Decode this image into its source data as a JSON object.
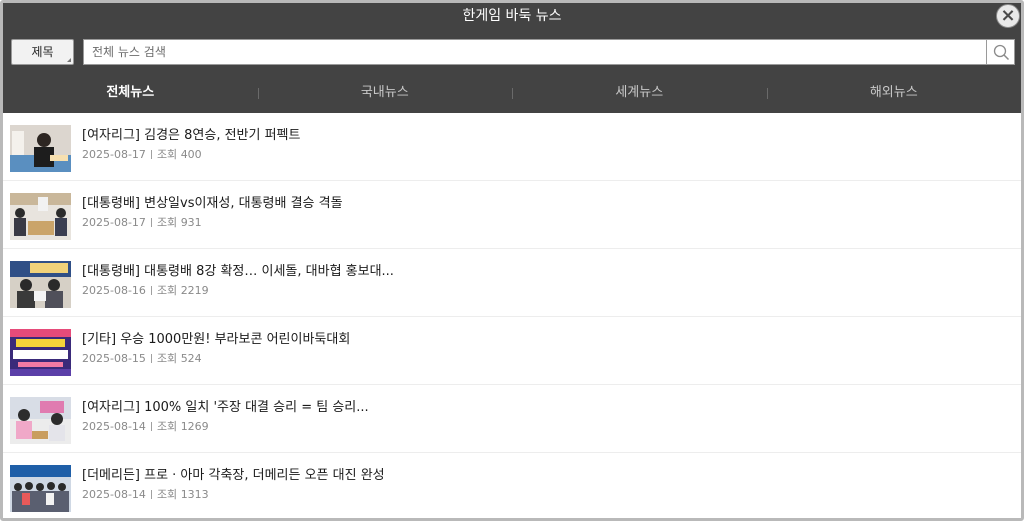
{
  "window": {
    "title": "한게임 바둑 뉴스",
    "close_icon": "close-icon"
  },
  "search": {
    "field_label": "제목",
    "placeholder": "전체 뉴스 검색",
    "value": "",
    "button_icon": "search-icon"
  },
  "tabs": [
    {
      "label": "전체뉴스",
      "active": true
    },
    {
      "label": "국내뉴스",
      "active": false
    },
    {
      "label": "세계뉴스",
      "active": false
    },
    {
      "label": "해외뉴스",
      "active": false
    }
  ],
  "news": [
    {
      "title": "[여자리그] 김경은 8연승, 전반기 퍼펙트",
      "date": "2025-08-17",
      "views_label": "조회",
      "views": "400"
    },
    {
      "title": "[대통령배] 변상일vs이재성, 대통령배 결승 격돌",
      "date": "2025-08-17",
      "views_label": "조회",
      "views": "931"
    },
    {
      "title": "[대통령배] 대통령배 8강 확정… 이세돌, 대바협 홍보대...",
      "date": "2025-08-16",
      "views_label": "조회",
      "views": "2219"
    },
    {
      "title": "[기타] 우승 1000만원! 부라보콘 어린이바둑대회",
      "date": "2025-08-15",
      "views_label": "조회",
      "views": "524"
    },
    {
      "title": "[여자리그] 100% 일치 '주장 대결 승리 = 팀 승리...",
      "date": "2025-08-14",
      "views_label": "조회",
      "views": "1269"
    },
    {
      "title": "[더메리든] 프로 · 아마 각축장, 더메리든 오픈 대진 완성",
      "date": "2025-08-14",
      "views_label": "조회",
      "views": "1313"
    }
  ],
  "colors": {
    "header_bg": "#434343",
    "active_tab": "#ffffff",
    "inactive_tab": "#c8c8c8",
    "meta_text": "#8a8a8a"
  }
}
